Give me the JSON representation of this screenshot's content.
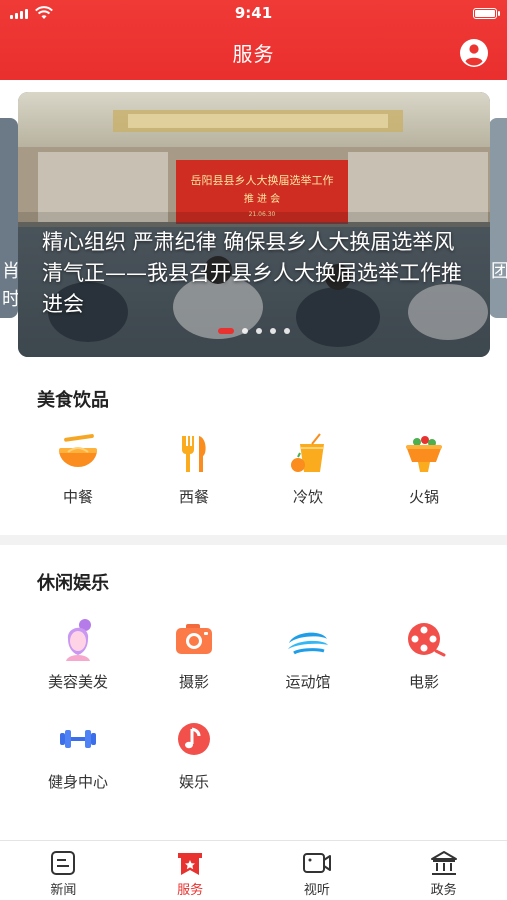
{
  "status_bar": {
    "time": "9:41"
  },
  "header": {
    "title": "服务"
  },
  "banner": {
    "sign_title": "岳阳县县乡人大换届选举工作",
    "sign_subtitle": "推 进 会",
    "sign_date": "21.06.30",
    "caption": "精心组织 严肃纪律 确保县乡人大换届选举风清气正——我县召开县乡人大换届选举工作推进会",
    "peek_left_text": "肖\n时",
    "peek_right_text": "团",
    "slide_count": 5,
    "active_slide": 1
  },
  "food_section": {
    "title": "美食饮品",
    "items": [
      {
        "label": "中餐",
        "icon": "noodle-bowl-icon"
      },
      {
        "label": "西餐",
        "icon": "fork-knife-icon"
      },
      {
        "label": "冷饮",
        "icon": "cold-drink-icon"
      },
      {
        "label": "火锅",
        "icon": "hotpot-icon"
      }
    ]
  },
  "leisure_section": {
    "title": "休闲娱乐",
    "items": [
      {
        "label": "美容美发",
        "icon": "beauty-hair-icon"
      },
      {
        "label": "摄影",
        "icon": "camera-icon"
      },
      {
        "label": "运动馆",
        "icon": "stadium-icon"
      },
      {
        "label": "电影",
        "icon": "film-reel-icon"
      },
      {
        "label": "健身中心",
        "icon": "dumbbell-icon"
      },
      {
        "label": "娱乐",
        "icon": "music-note-icon"
      }
    ]
  },
  "tabbar": {
    "items": [
      {
        "label": "新闻",
        "icon": "news-icon",
        "active": false
      },
      {
        "label": "服务",
        "icon": "service-icon",
        "active": true
      },
      {
        "label": "视听",
        "icon": "video-icon",
        "active": false
      },
      {
        "label": "政务",
        "icon": "government-icon",
        "active": false
      }
    ]
  },
  "colors": {
    "accent": "#e8322f",
    "header_bg": "#ec3531",
    "page_bg": "#f2f2f2"
  }
}
